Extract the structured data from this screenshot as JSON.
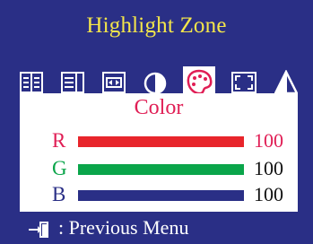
{
  "menu": {
    "title": "Highlight Zone",
    "tabs": [
      {
        "name": "contrast-tab",
        "icon": "panel-lines-icon"
      },
      {
        "name": "image-tab",
        "icon": "panel-columns-icon"
      },
      {
        "name": "position-tab",
        "icon": "panel-arrows-icon"
      },
      {
        "name": "brightness-tab",
        "icon": "half-circle-icon"
      },
      {
        "name": "color-tab",
        "icon": "palette-icon",
        "selected": true
      },
      {
        "name": "size-tab",
        "icon": "frame-corners-icon"
      },
      {
        "name": "triangle-tab",
        "icon": "triangle-icon"
      }
    ]
  },
  "panel": {
    "title": "Color",
    "channels": [
      {
        "label": "R",
        "value": "100",
        "level": 1.0,
        "color": "#e8252b",
        "label_color": "#e01e55",
        "value_color": "#e01e55"
      },
      {
        "label": "G",
        "value": "100",
        "level": 1.0,
        "color": "#0aa54a",
        "label_color": "#0aa54a",
        "value_color": "#111111"
      },
      {
        "label": "B",
        "value": "100",
        "level": 1.0,
        "color": "#2a2f86",
        "label_color": "#2a2f86",
        "value_color": "#111111"
      }
    ]
  },
  "footer": {
    "label": ": Previous Menu",
    "icon": "exit-door-icon"
  },
  "colors": {
    "background": "#2a2f86",
    "title": "#f4e64a",
    "panel": "#ffffff",
    "highlight": "#e01e55"
  }
}
